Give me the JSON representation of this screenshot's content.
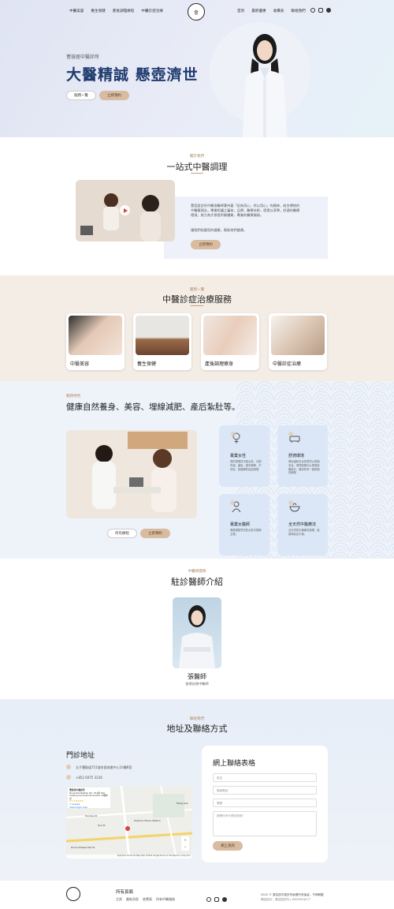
{
  "nav": {
    "left": [
      "中醫美容",
      "養生保健",
      "產後調理療程",
      "中醫診症治療"
    ],
    "right": [
      "首頁",
      "最新優惠",
      "收費表",
      "聯絡我們"
    ]
  },
  "logo": {
    "text": "會"
  },
  "social_icons": [
    "whatsapp-icon",
    "instagram-icon",
    "facebook-icon"
  ],
  "hero": {
    "subtitle": "蓍容居中醫診所",
    "title": "大醫精誠 懸壺濟世",
    "btn_services": "服務一覽",
    "btn_book": "立即預約"
  },
  "about": {
    "label": "關於我們",
    "title": "一站式中醫調理",
    "text": "蓍容居診所中醫張醫師秉持著「因為用心，所以用心」的精神，結合傳統的中醫藥理念，專業照護之審核，品牌，醫療技術，提提以享學，舒適的醫療環境，致力為大眾提供最優質，專業的醫療服務。",
    "text2": "讓我們陪著您的健康，幫助他們健康。",
    "button": "立即預約"
  },
  "services": {
    "label": "服務一覽",
    "title": "中醫診症治療服務",
    "items": [
      "中醫美容",
      "養生保健",
      "產後調理療身",
      "中醫診症治療"
    ]
  },
  "features": {
    "label": "服務特色",
    "title": "健康自然養身、美容、埋線減肥、產后紮肚等。",
    "btn_all": "所有療程",
    "btn_book": "立即預約",
    "cards": [
      {
        "title": "專業女性",
        "desc": "提供專業的中醫女性，月經失調，產後，更年期等，不孕症，各種婦科症狀調理"
      },
      {
        "title": "舒適環境",
        "desc": "專用溫和安全的環境以舒適安全。環境配置均以專業設備設計，讓你們享一個舒適的療程"
      },
      {
        "title": "專業女醫師",
        "desc": "專業經驗豐富的女性中醫師主理。"
      },
      {
        "title": "全天然中醫療法",
        "desc": "全天然的中藥藥材調理，能調和氣血平衡。"
      }
    ]
  },
  "doctor": {
    "label": "中醫師團隊",
    "title": "駐診醫師介紹",
    "name": "張醫師",
    "role": "香港註冊中醫師"
  },
  "contact": {
    "label": "聯絡我們",
    "title": "地址及聯絡方式",
    "clinic_heading": "門診地址",
    "address": "太子彌敦道751號合昌商業中心10樓B室",
    "phone": "+852 6975 3236",
    "form_title": "網上聯絡表格",
    "field_name": "姓名",
    "field_phone": "聯絡電話",
    "field_email": "電郵",
    "field_message": "請問你有什麼查詢呢？",
    "submit": "網上查詢",
    "map": {
      "place_name": "蓍容居中醫診所",
      "address_line": "Hong Kok Nathan Rd, 751號 Hop Cheong Commercial Centre, 10樓B室",
      "rating": "5.0 ★★★★★",
      "reviews": "7 reviews",
      "link": "View larger map",
      "streets": [
        "Prince Edward Rd W",
        "Soy St",
        "Dundas St",
        "Kowloon Police Station",
        "Mong Kok"
      ],
      "credit": "Keyboard shortcuts    Map data ©2022 Google    Terms of Use    Report a map error"
    }
  },
  "footer": {
    "title": "所有頁面",
    "links": [
      "主頁",
      "最新消息",
      "收費表",
      "所有中醫服務"
    ],
    "copyright": "2022 © 蓍容居中醫診所版權所有保留 - 不得轉載",
    "credit": "網站設計：蓍容居診所 | WEBPROJECT"
  }
}
